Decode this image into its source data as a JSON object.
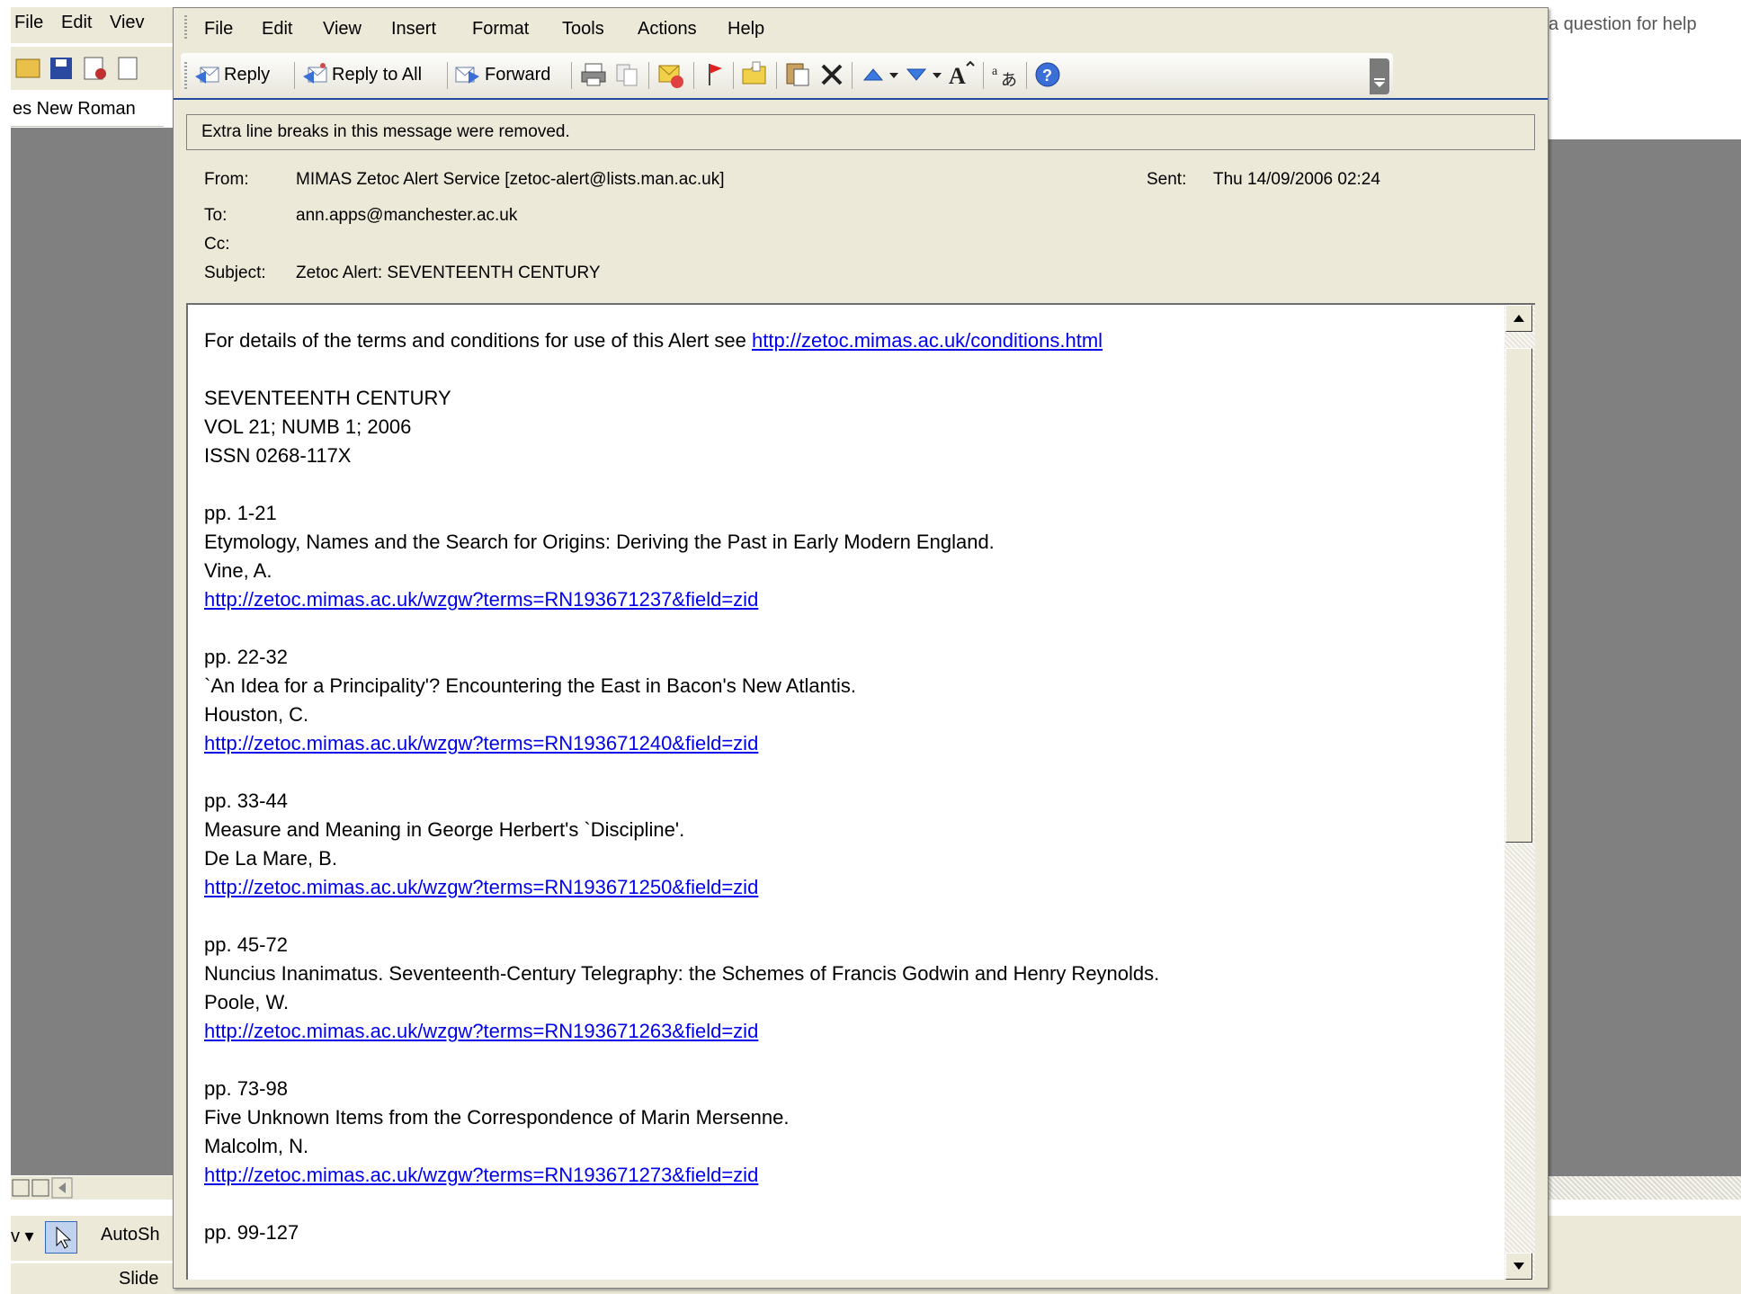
{
  "background_app": {
    "menu": [
      "File",
      "Edit",
      "Viev"
    ],
    "font_box": "es New Roman",
    "help_text": "a question for help",
    "draw_label": "AutoSh",
    "draw_tail": "v ▾",
    "status_label": "Slide"
  },
  "menubar": {
    "items": [
      "File",
      "Edit",
      "View",
      "Insert",
      "Format",
      "Tools",
      "Actions",
      "Help"
    ]
  },
  "toolbar": {
    "reply": "Reply",
    "reply_all": "Reply to All",
    "forward": "Forward"
  },
  "infobar": "Extra line breaks in this message were removed.",
  "header": {
    "from_label": "From:",
    "from_value": "MIMAS Zetoc Alert Service [zetoc-alert@lists.man.ac.uk]",
    "sent_label": "Sent:",
    "sent_value": "Thu 14/09/2006 02:24",
    "to_label": "To:",
    "to_value": "ann.apps@manchester.ac.uk",
    "cc_label": "Cc:",
    "cc_value": "",
    "subject_label": "Subject:",
    "subject_value": "Zetoc Alert: SEVENTEENTH CENTURY"
  },
  "body": {
    "terms_text": "For details of the terms and conditions for use of this Alert see ",
    "terms_link": "http://zetoc.mimas.ac.uk/conditions.html",
    "journal": "SEVENTEENTH CENTURY",
    "volume": "VOL 21; NUMB 1; 2006",
    "issn": "ISSN 0268-117X",
    "articles": [
      {
        "pages": "pp. 1-21",
        "title": "Etymology, Names and the Search for Origins: Deriving the Past in Early Modern England.",
        "author": "Vine, A.",
        "url": "http://zetoc.mimas.ac.uk/wzgw?terms=RN193671237&field=zid"
      },
      {
        "pages": "pp. 22-32",
        "title": "`An Idea for a Principality'? Encountering the East in Bacon's New Atlantis.",
        "author": "Houston, C.",
        "url": "http://zetoc.mimas.ac.uk/wzgw?terms=RN193671240&field=zid"
      },
      {
        "pages": "pp. 33-44",
        "title": "Measure and Meaning in George Herbert's `Discipline'.",
        "author": "De La Mare, B.",
        "url": "http://zetoc.mimas.ac.uk/wzgw?terms=RN193671250&field=zid"
      },
      {
        "pages": "pp. 45-72",
        "title": "Nuncius Inanimatus. Seventeenth-Century Telegraphy: the Schemes of Francis Godwin and Henry Reynolds.",
        "author": "Poole, W.",
        "url": "http://zetoc.mimas.ac.uk/wzgw?terms=RN193671263&field=zid"
      },
      {
        "pages": "pp. 73-98",
        "title": "Five Unknown Items from the Correspondence of Marin Mersenne.",
        "author": "Malcolm, N.",
        "url": "http://zetoc.mimas.ac.uk/wzgw?terms=RN193671273&field=zid"
      },
      {
        "pages": "pp. 99-127",
        "title": "",
        "author": "",
        "url": ""
      }
    ]
  },
  "colors": {
    "chrome": "#ece9d8",
    "link": "#0000ee",
    "divider": "#1f4aa0",
    "backdrop": "#808080"
  },
  "icons": [
    "reply-icon",
    "reply-all-icon",
    "forward-icon",
    "print-icon",
    "copy-icon",
    "move-icon",
    "flag-icon",
    "open-folder-icon",
    "paste-icon",
    "delete-icon",
    "previous-icon",
    "next-icon",
    "font-size-icon",
    "translate-icon",
    "help-icon"
  ]
}
